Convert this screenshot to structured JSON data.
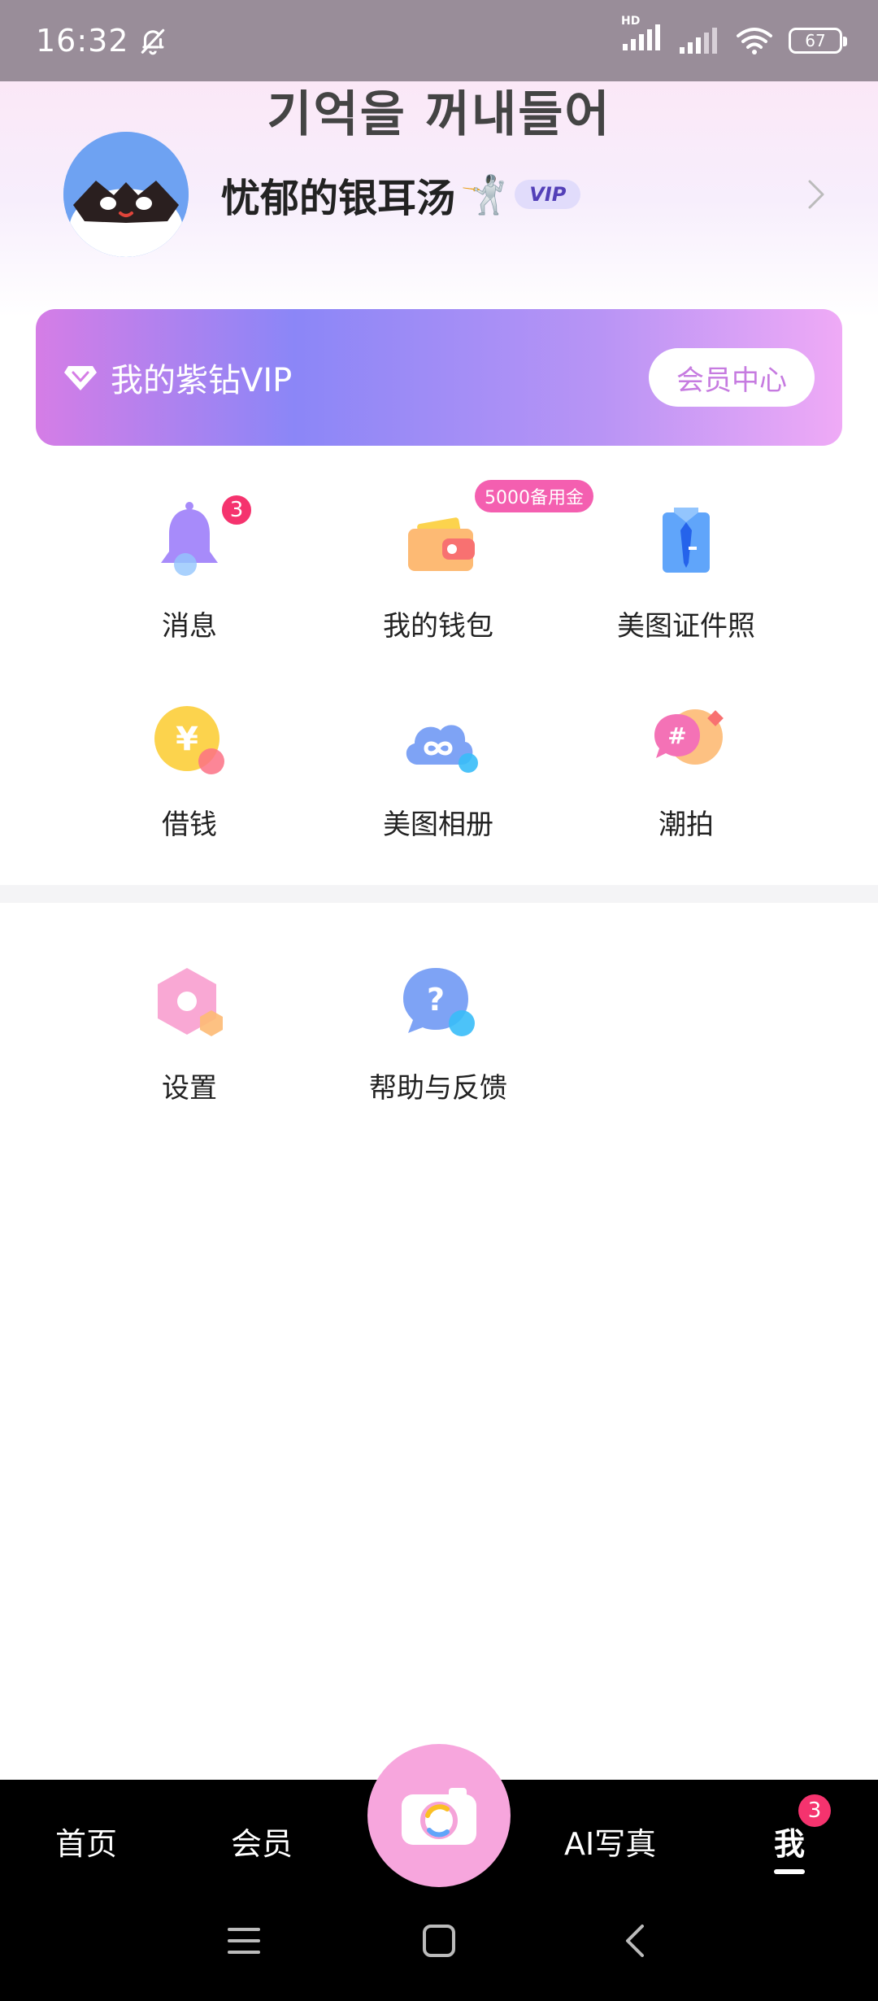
{
  "status_bar": {
    "time": "16:32",
    "network_label": "HD",
    "battery": "67",
    "icons": [
      "bell-off-icon",
      "signal-icon",
      "signal-icon",
      "wifi-icon",
      "battery-icon"
    ]
  },
  "header": {
    "overlay_text": "기억을 꺼내들어",
    "username": "忧郁的银耳汤",
    "username_emoji": "🤺",
    "vip_badge": "VIP"
  },
  "vip_banner": {
    "title": "我的紫钻VIP",
    "button": "会员中心"
  },
  "grid": {
    "items": [
      {
        "label": "消息",
        "badge": "3",
        "icon": "bell-icon"
      },
      {
        "label": "我的钱包",
        "promo": "5000备用金",
        "icon": "wallet-icon"
      },
      {
        "label": "美图证件照",
        "icon": "id-photo-icon"
      },
      {
        "label": "借钱",
        "icon": "yuan-coin-icon"
      },
      {
        "label": "美图相册",
        "icon": "cloud-infinity-icon"
      },
      {
        "label": "潮拍",
        "icon": "hashtag-chat-icon"
      }
    ],
    "secondary": [
      {
        "label": "设置",
        "icon": "settings-hexagon-icon"
      },
      {
        "label": "帮助与反馈",
        "icon": "help-question-icon"
      }
    ]
  },
  "bottom_nav": {
    "items": [
      "首页",
      "会员",
      "AI写真",
      "我"
    ],
    "active": "我",
    "me_badge": "3"
  },
  "colors": {
    "accent_pink": "#f5336e",
    "vip_gradient_start": "#d57de6",
    "vip_gradient_mid": "#8b86f7",
    "camera_button": "#f7a6dd"
  }
}
